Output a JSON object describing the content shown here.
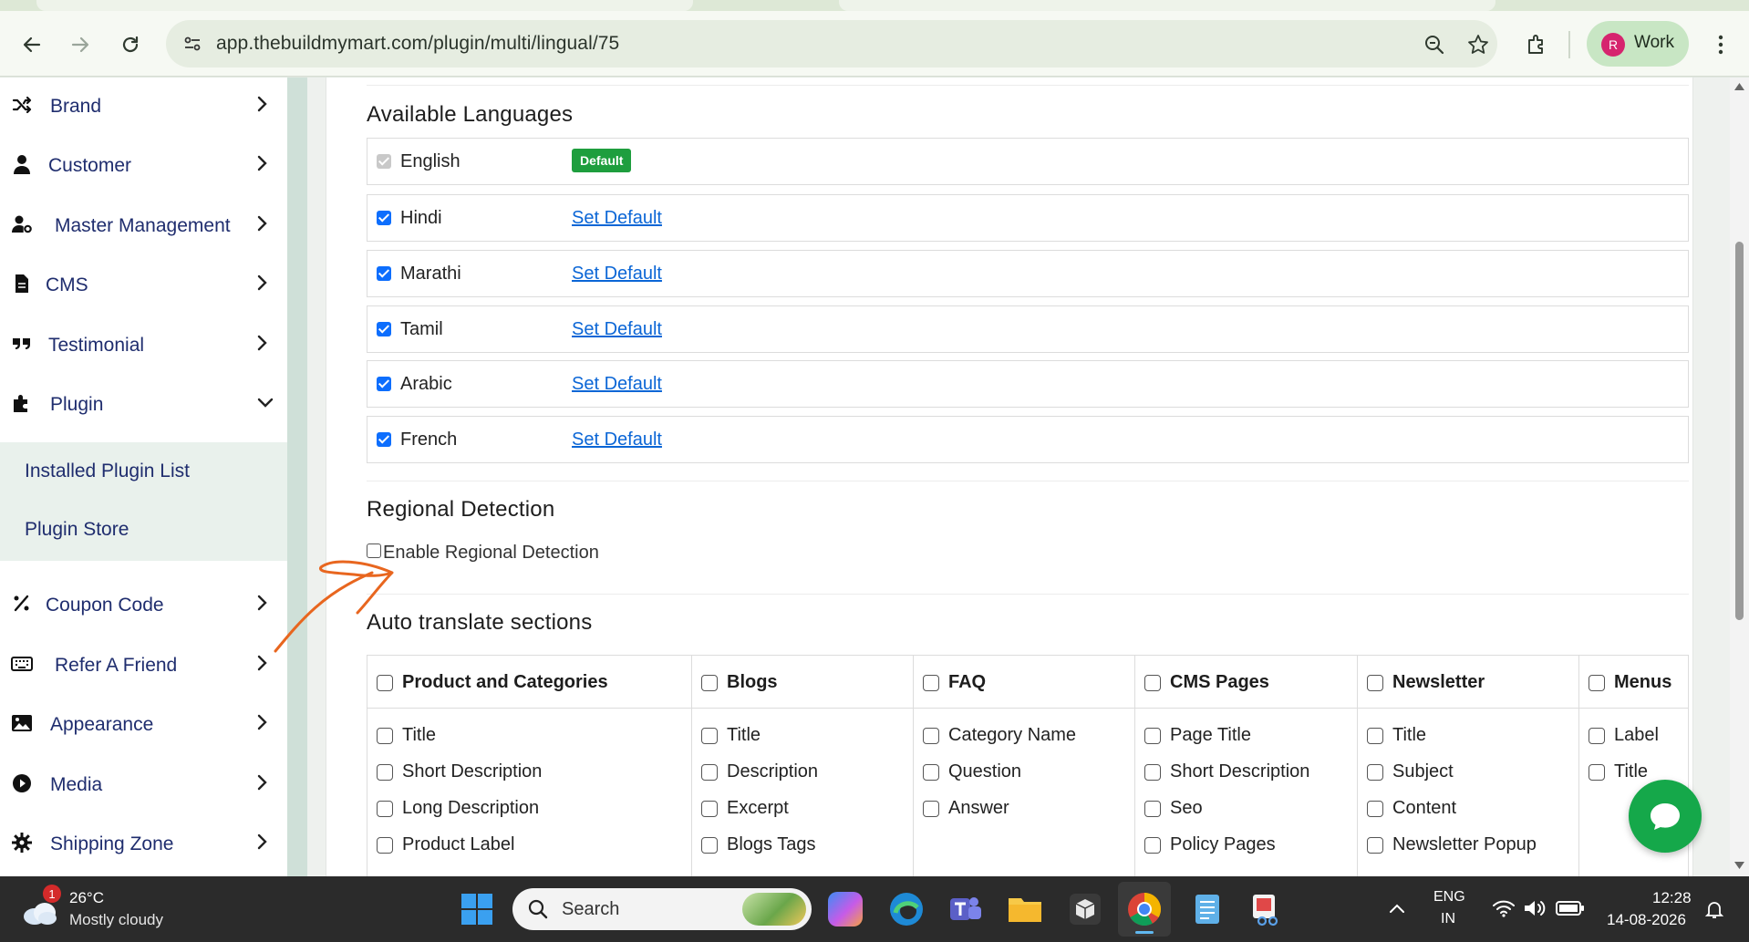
{
  "browser": {
    "url": "app.thebuildmymart.com/plugin/multi/lingual/75",
    "profile_initial": "R",
    "profile_label": "Work"
  },
  "sidebar": {
    "items": [
      {
        "label": "Brand",
        "icon": "shuffle-icon"
      },
      {
        "label": "Customer",
        "icon": "user-icon"
      },
      {
        "label": "Master Management",
        "icon": "users-cog-icon"
      },
      {
        "label": "CMS",
        "icon": "file-icon"
      },
      {
        "label": "Testimonial",
        "icon": "quote-icon"
      },
      {
        "label": "Plugin",
        "icon": "puzzle-icon"
      },
      {
        "label": "Coupon Code",
        "icon": "percent-icon"
      },
      {
        "label": "Refer A Friend",
        "icon": "keyboard-icon"
      },
      {
        "label": "Appearance",
        "icon": "image-icon"
      },
      {
        "label": "Media",
        "icon": "play-circle-icon"
      },
      {
        "label": "Shipping Zone",
        "icon": "gear-icon"
      }
    ],
    "plugin_submenu": [
      "Installed Plugin List",
      "Plugin Store"
    ]
  },
  "languages": {
    "title": "Available Languages",
    "default_badge": "Default",
    "set_default_label": "Set Default",
    "rows": [
      {
        "name": "English",
        "checked": true,
        "is_default": true
      },
      {
        "name": "Hindi",
        "checked": true,
        "is_default": false
      },
      {
        "name": "Marathi",
        "checked": true,
        "is_default": false
      },
      {
        "name": "Tamil",
        "checked": true,
        "is_default": false
      },
      {
        "name": "Arabic",
        "checked": true,
        "is_default": false
      },
      {
        "name": "French",
        "checked": true,
        "is_default": false
      }
    ]
  },
  "regional": {
    "title": "Regional Detection",
    "checkbox_label": "Enable Regional Detection",
    "checked": false
  },
  "auto_translate": {
    "title": "Auto translate sections",
    "columns": [
      {
        "header": "Product and Categories",
        "items": [
          "Title",
          "Short Description",
          "Long Description",
          "Product Label"
        ]
      },
      {
        "header": "Blogs",
        "items": [
          "Title",
          "Description",
          "Excerpt",
          "Blogs Tags"
        ]
      },
      {
        "header": "FAQ",
        "items": [
          "Category Name",
          "Question",
          "Answer"
        ]
      },
      {
        "header": "CMS Pages",
        "items": [
          "Page Title",
          "Short Description",
          "Seo",
          "Policy Pages"
        ]
      },
      {
        "header": "Newsletter",
        "items": [
          "Title",
          "Subject",
          "Content",
          "Newsletter Popup"
        ]
      },
      {
        "header": "Menus",
        "items": [
          "Label",
          "Title"
        ]
      }
    ]
  },
  "taskbar": {
    "weather_temp": "26°C",
    "weather_desc": "Mostly cloudy",
    "weather_badge": "1",
    "search_label": "Search",
    "lang_top": "ENG",
    "lang_bottom": "IN",
    "time": "12:28",
    "date": "14-08-2026"
  },
  "colors": {
    "accent_blue": "#0d6efd",
    "link_blue": "#0b66d6",
    "badge_green": "#1e9e3e",
    "chat_green": "#15a84a",
    "annotation_orange": "#e8661f"
  }
}
